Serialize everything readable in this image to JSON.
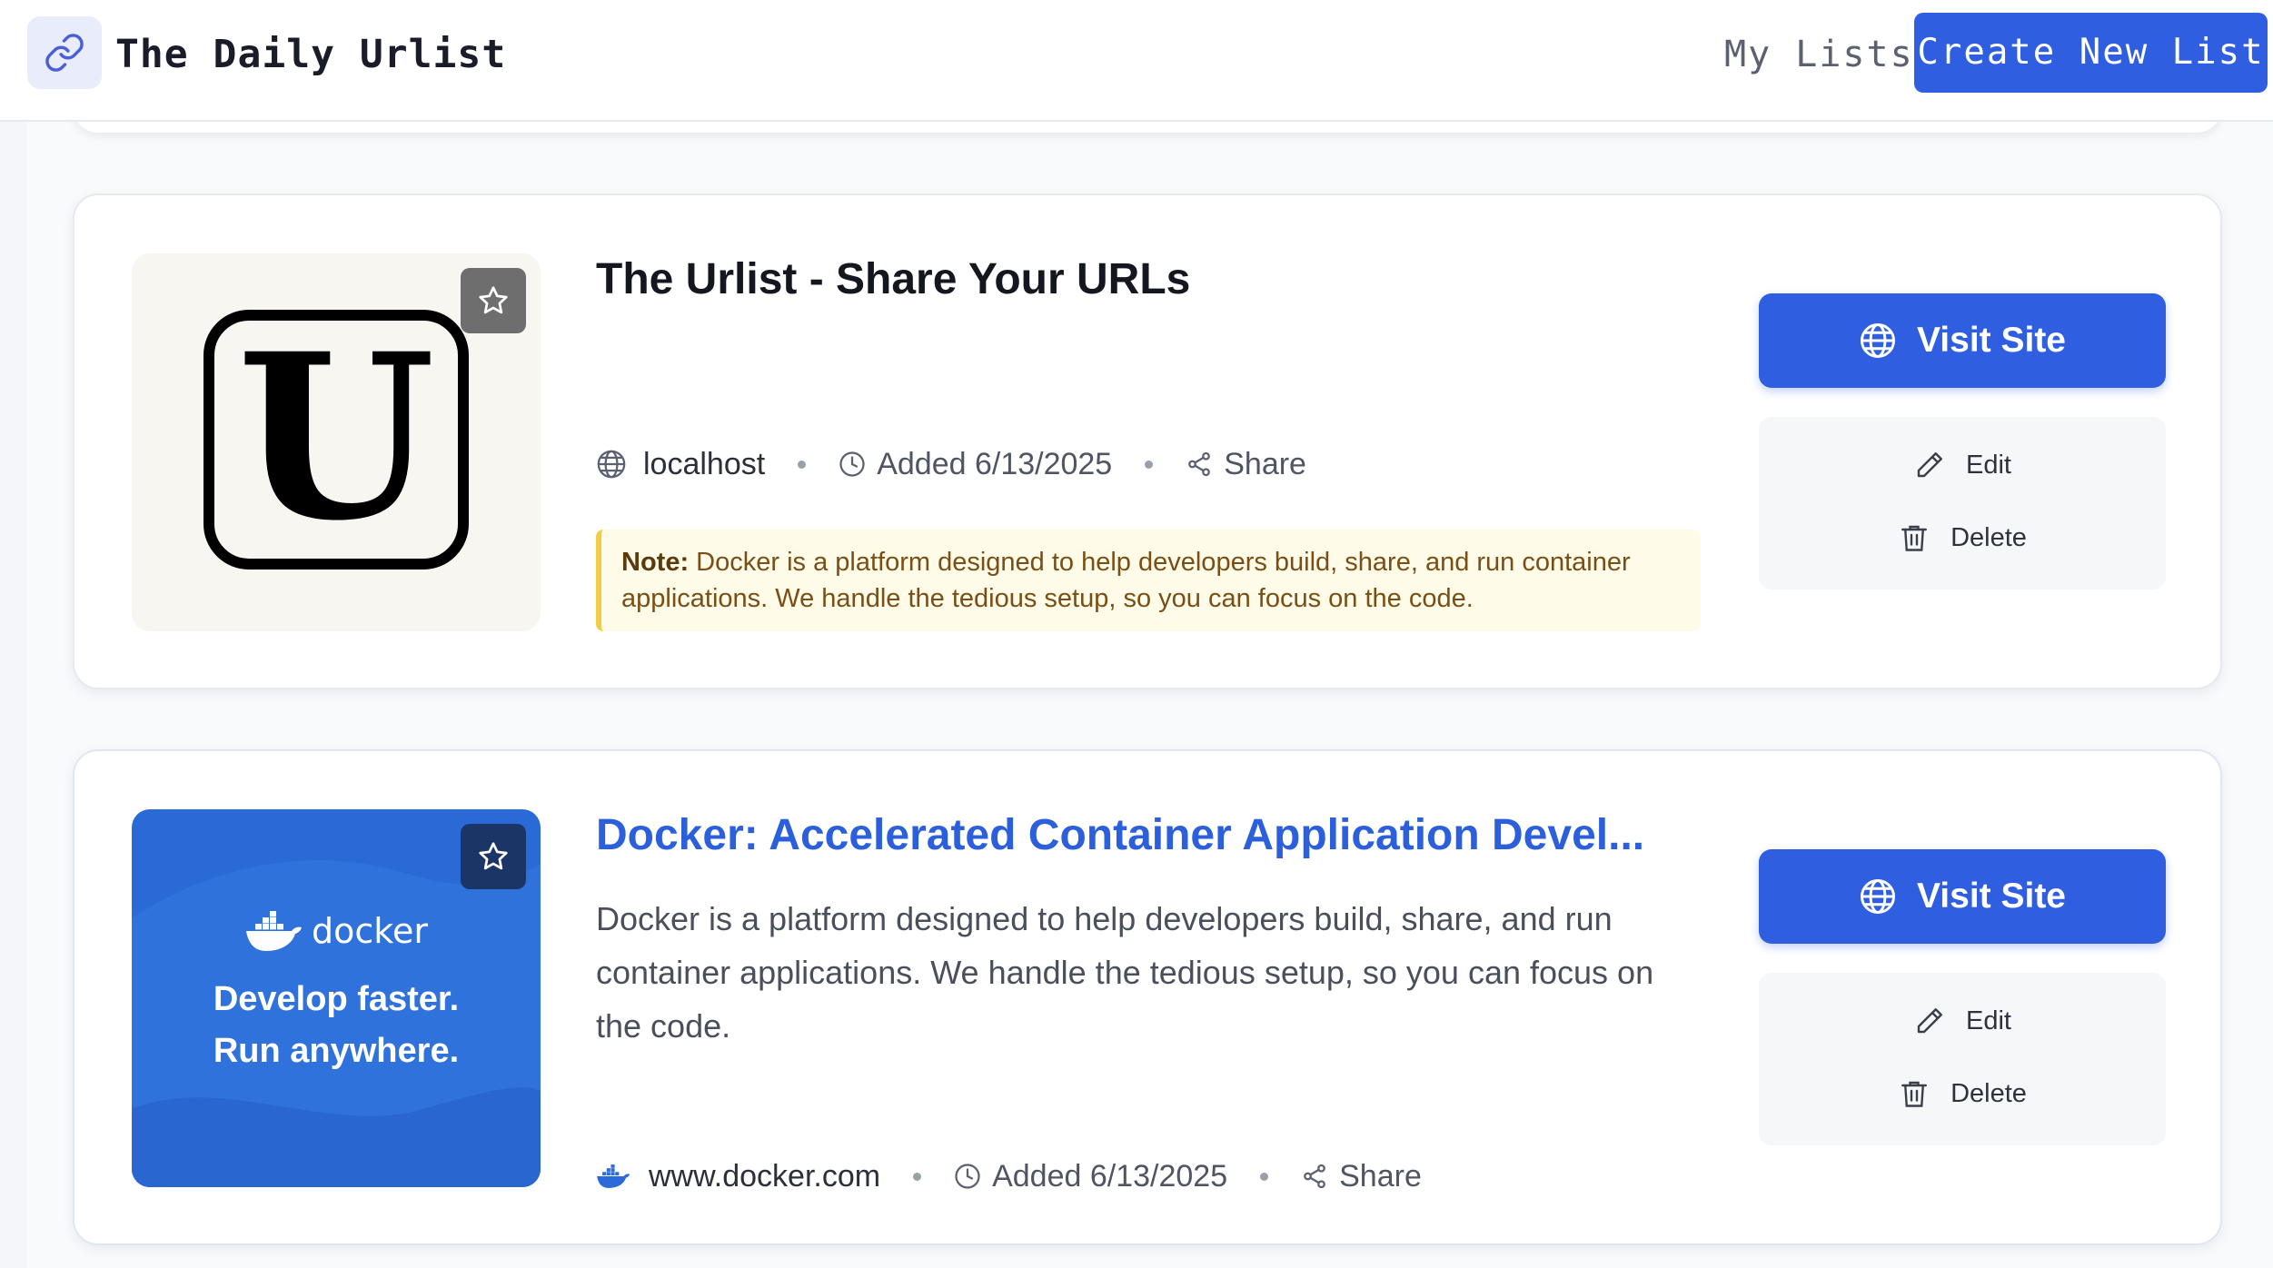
{
  "header": {
    "app_title": "The Daily Urlist",
    "nav_my_lists": "My Lists",
    "create_button": "Create New List"
  },
  "cards": [
    {
      "title": "The Urlist - Share Your URLs",
      "host": "localhost",
      "added": "Added 6/13/2025",
      "share": "Share",
      "note_label": "Note:",
      "note_text": "Docker is a platform designed to help developers build, share, and run container applications. We handle the tedious setup, so you can focus on the code.",
      "visit_label": "Visit Site",
      "edit_label": "Edit",
      "delete_label": "Delete"
    },
    {
      "title": "Docker: Accelerated Container Application Devel...",
      "description": "Docker is a platform designed to help developers build, share, and run container applications. We handle the tedious setup, so you can focus on the code.",
      "thumb_brand": "docker",
      "thumb_line1": "Develop faster.",
      "thumb_line2": "Run anywhere.",
      "host": "www.docker.com",
      "added": "Added 6/13/2025",
      "share": "Share",
      "visit_label": "Visit Site",
      "edit_label": "Edit",
      "delete_label": "Delete"
    }
  ],
  "colors": {
    "primary": "#2f5fe0",
    "note_bg": "#fefbe8",
    "note_border": "#f1cd45",
    "docker_bg": "#2a6ad6"
  },
  "icons": [
    "link-icon",
    "star-icon",
    "globe-icon",
    "clock-icon",
    "share-icon",
    "pencil-icon",
    "trash-icon",
    "docker-whale-icon"
  ]
}
